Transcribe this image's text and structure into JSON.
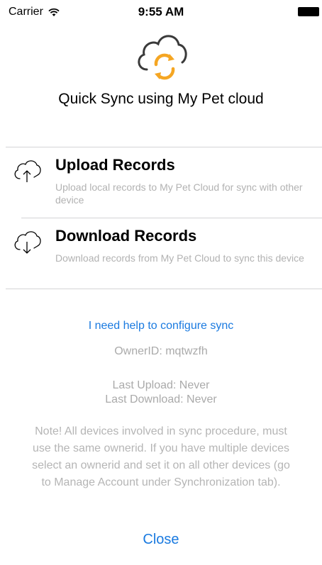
{
  "status_bar": {
    "carrier": "Carrier",
    "time": "9:55 AM"
  },
  "header": {
    "icon": "cloud-sync-icon",
    "title": "Quick Sync using My Pet cloud",
    "colors": {
      "cloud_outline": "#3a3a3a",
      "sync_arrows": "#f5a623"
    }
  },
  "options": [
    {
      "title": "Upload Records",
      "description": "Upload local records to My Pet Cloud for sync with other device",
      "icon": "cloud-upload-icon"
    },
    {
      "title": "Download Records",
      "description": "Download records from My Pet Cloud to sync this device",
      "icon": "cloud-download-icon"
    }
  ],
  "help_link": "I need help to configure sync",
  "info": {
    "owner_id": "OwnerID: mqtwzfh",
    "last_upload": "Last Upload: Never",
    "last_download": "Last Download: Never"
  },
  "note": "Note! All devices involved in sync procedure, must\nuse the same ownerid. If you have multiple devices\nselect an ownerid and set it on all other devices (go\nto Manage Account under Synchronization tab).",
  "close_label": "Close",
  "colors": {
    "link": "#1a7ae0",
    "muted_text": "#b2b2b2",
    "divider": "#d4d4d6"
  }
}
